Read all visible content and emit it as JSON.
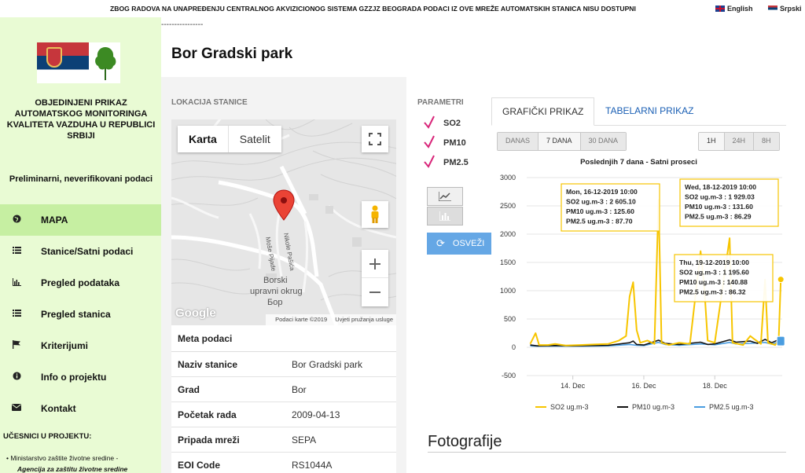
{
  "notice": "ZBOG RADOVA NA UNAPREĐENJU CENTRALNOG AKVIZICIONOG SISTEMA GZZJZ BEOGRADA PODACI IZ OVE MREŽE AUTOMATSKIH STANICA NISU DOSTUPNI",
  "languages": {
    "english": "English",
    "serbian": "Srpski"
  },
  "dashes": "----------------",
  "org_name": "OBJEDINJENI PRIKAZ AUTOMATSKOG MONITORINGA KVALITETA VAZDUHA U REPUBLICI SRBIJI",
  "preliminary": "Preliminarni, neverifikovani podaci",
  "nav": [
    {
      "label": "MAPA",
      "icon": "globe-icon",
      "active": true
    },
    {
      "label": "Stanice/Satni podaci",
      "icon": "list-icon"
    },
    {
      "label": "Pregled podataka",
      "icon": "bar-chart-icon"
    },
    {
      "label": "Pregled stanica",
      "icon": "list-icon"
    },
    {
      "label": "Kriterijumi",
      "icon": "flag-icon"
    },
    {
      "label": "Info o projektu",
      "icon": "info-icon"
    },
    {
      "label": "Kontakt",
      "icon": "envelope-icon"
    }
  ],
  "participants_title": "UČESNICI U PROJEKTU:",
  "participants": [
    "Ministarstvo zaštite životne sredine -",
    "Agencija za zaštitu životne sredine"
  ],
  "station_title": "Bor Gradski park",
  "location_label": "LOKACIJA STANICE",
  "map": {
    "type_map": "Karta",
    "type_satellite": "Satelit",
    "google": "Google",
    "copyright": "Podaci karte ©2019",
    "terms": "Uvjeti pružanja usluge",
    "region_label": [
      "Borski",
      "upravni okrug",
      "Бор"
    ],
    "street1": "Moše Pijade",
    "street2": "Nikole Pašića"
  },
  "meta": {
    "title": "Meta podaci",
    "rows": [
      {
        "k": "Naziv stanice",
        "v": "Bor Gradski park"
      },
      {
        "k": "Grad",
        "v": "Bor"
      },
      {
        "k": "Početak rada",
        "v": "2009-04-13"
      },
      {
        "k": "Pripada mreži",
        "v": "SEPA"
      },
      {
        "k": "EOI Code",
        "v": "RS1044A"
      }
    ]
  },
  "params_label": "PARAMETRI",
  "params": [
    "SO2",
    "PM10",
    "PM2.5"
  ],
  "refresh_label": "OSVEŽI",
  "tabs": {
    "graph": "GRAFIČKI PRIKAZ",
    "table": "TABELARNI PRIKAZ"
  },
  "range_days": [
    {
      "label": "DANAS"
    },
    {
      "label": "7 DANA",
      "on": true
    },
    {
      "label": "30 DANA"
    }
  ],
  "range_hours": [
    {
      "label": "1H",
      "on": true
    },
    {
      "label": "24H"
    },
    {
      "label": "8H"
    }
  ],
  "colors": {
    "so2": "#f7c500",
    "pm10": "#111111",
    "pm25": "#4a9de0",
    "sidebar": "#e9fbd4",
    "active_nav": "#c6efa2",
    "button": "#65a7e5",
    "check": "#d8267a"
  },
  "chart_data": {
    "type": "line",
    "title": "Poslednjih 7 dana - Satni proseci",
    "ylim": [
      -500,
      3000
    ],
    "yticks": [
      3000,
      2500,
      2000,
      1500,
      1000,
      500,
      0,
      -500
    ],
    "xticks": [
      "14. Dec",
      "16. Dec",
      "18. Dec"
    ],
    "x_days": [
      12.7,
      19.9
    ],
    "series": [
      {
        "name": "SO2 ug.m-3",
        "points": [
          [
            12.8,
            60
          ],
          [
            12.95,
            250
          ],
          [
            13.05,
            40
          ],
          [
            13.3,
            40
          ],
          [
            13.5,
            60
          ],
          [
            13.8,
            30
          ],
          [
            14.2,
            40
          ],
          [
            14.6,
            50
          ],
          [
            15.0,
            60
          ],
          [
            15.3,
            120
          ],
          [
            15.5,
            200
          ],
          [
            15.6,
            900
          ],
          [
            15.7,
            1150
          ],
          [
            15.8,
            300
          ],
          [
            15.9,
            80
          ],
          [
            16.1,
            120
          ],
          [
            16.3,
            60
          ],
          [
            16.416,
            2605.1
          ],
          [
            16.5,
            80
          ],
          [
            16.7,
            40
          ],
          [
            17.0,
            80
          ],
          [
            17.3,
            60
          ],
          [
            17.6,
            1700
          ],
          [
            17.7,
            1100
          ],
          [
            17.8,
            120
          ],
          [
            18.0,
            80
          ],
          [
            18.417,
            1929.03
          ],
          [
            18.5,
            80
          ],
          [
            18.8,
            40
          ],
          [
            19.0,
            200
          ],
          [
            19.1,
            150
          ],
          [
            19.3,
            60
          ],
          [
            19.417,
            1195.6
          ],
          [
            19.5,
            80
          ],
          [
            19.7,
            40
          ],
          [
            19.8,
            120
          ],
          [
            19.86,
            1200
          ]
        ]
      },
      {
        "name": "PM10 ug.m-3",
        "points": [
          [
            12.8,
            40
          ],
          [
            13.0,
            25
          ],
          [
            13.5,
            30
          ],
          [
            14.0,
            25
          ],
          [
            14.5,
            30
          ],
          [
            15.0,
            35
          ],
          [
            15.6,
            80
          ],
          [
            15.7,
            110
          ],
          [
            15.8,
            50
          ],
          [
            16.0,
            40
          ],
          [
            16.416,
            125.6
          ],
          [
            16.6,
            70
          ],
          [
            17.0,
            50
          ],
          [
            17.6,
            90
          ],
          [
            17.8,
            50
          ],
          [
            18.0,
            60
          ],
          [
            18.417,
            131.6
          ],
          [
            18.6,
            90
          ],
          [
            19.0,
            110
          ],
          [
            19.2,
            70
          ],
          [
            19.417,
            140.88
          ],
          [
            19.6,
            80
          ],
          [
            19.86,
            150
          ]
        ]
      },
      {
        "name": "PM2.5 ug.m-3",
        "points": [
          [
            12.8,
            25
          ],
          [
            13.0,
            20
          ],
          [
            13.5,
            22
          ],
          [
            14.0,
            20
          ],
          [
            14.5,
            22
          ],
          [
            15.0,
            25
          ],
          [
            15.6,
            50
          ],
          [
            15.8,
            35
          ],
          [
            16.0,
            30
          ],
          [
            16.416,
            87.7
          ],
          [
            16.6,
            50
          ],
          [
            17.0,
            35
          ],
          [
            17.6,
            60
          ],
          [
            18.0,
            45
          ],
          [
            18.417,
            86.29
          ],
          [
            18.6,
            60
          ],
          [
            19.0,
            70
          ],
          [
            19.417,
            86.32
          ],
          [
            19.6,
            55
          ],
          [
            19.86,
            110
          ]
        ]
      }
    ],
    "tooltips": [
      {
        "date": "Mon, 16-12-2019 10:00",
        "so2": "SO2 ug.m-3 : 2 605.10",
        "pm10": "PM10 ug.m-3 : 125.60",
        "pm25": "PM2.5 ug.m-3 : 87.70"
      },
      {
        "date": "Wed, 18-12-2019 10:00",
        "so2": "SO2 ug.m-3 : 1 929.03",
        "pm10": "PM10 ug.m-3 : 131.60",
        "pm25": "PM2.5 ug.m-3 : 86.29"
      },
      {
        "date": "Thu, 19-12-2019 10:00",
        "so2": "SO2 ug.m-3 : 1 195.60",
        "pm10": "PM10 ug.m-3 : 140.88",
        "pm25": "PM2.5 ug.m-3 : 86.32"
      }
    ]
  },
  "photos_title": "Fotografije"
}
